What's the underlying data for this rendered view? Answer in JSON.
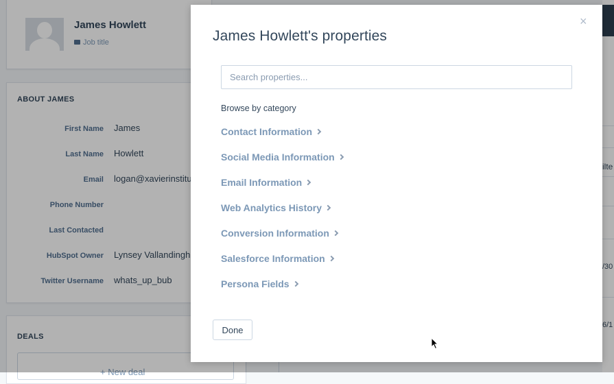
{
  "profile": {
    "name": "James Howlett",
    "job_title": "Job title"
  },
  "about": {
    "title": "ABOUT JAMES",
    "properties": [
      {
        "label": "First Name",
        "value": "James"
      },
      {
        "label": "Last Name",
        "value": "Howlett"
      },
      {
        "label": "Email",
        "value": "logan@xavierinstitu"
      },
      {
        "label": "Phone Number",
        "value": ""
      },
      {
        "label": "Last Contacted",
        "value": ""
      },
      {
        "label": "HubSpot Owner",
        "value": "Lynsey Vallandingh"
      },
      {
        "label": "Twitter Username",
        "value": "whats_up_bub"
      }
    ]
  },
  "deals": {
    "title": "DEALS",
    "new_deal_label": "+ New deal"
  },
  "right_panel": {
    "filter_text": "ilte",
    "date1": "/30",
    "date2": "6/1"
  },
  "modal": {
    "title": "James Howlett's properties",
    "close_glyph": "×",
    "search_placeholder": "Search properties...",
    "browse_label": "Browse by category",
    "categories": [
      "Contact Information",
      "Social Media Information",
      "Email Information",
      "Web Analytics History",
      "Conversion Information",
      "Salesforce Information",
      "Persona Fields"
    ],
    "done_label": "Done"
  },
  "icons": {
    "job_title_icon": "briefcase-icon",
    "close_icon": "close-icon",
    "category_chevron": "chevron-right-icon",
    "avatar": "person-silhouette"
  }
}
